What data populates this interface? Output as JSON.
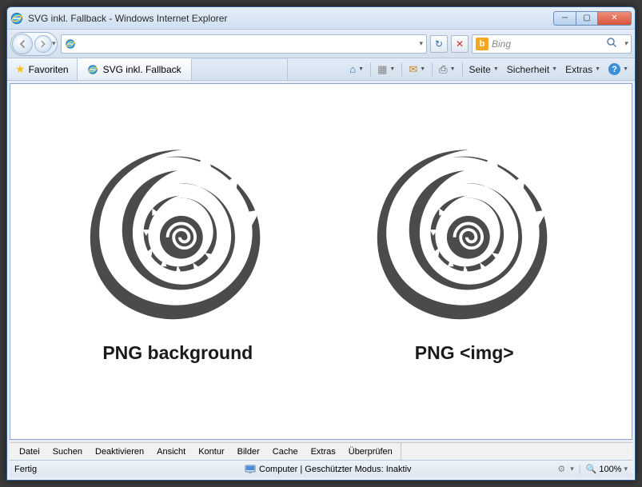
{
  "titlebar": {
    "title": "SVG inkl. Fallback - Windows Internet Explorer"
  },
  "navbar": {
    "address": "",
    "refresh_icon": "↻",
    "stop_icon": "✕",
    "search_engine": "b",
    "search_placeholder": "Bing"
  },
  "favrow": {
    "favorites_label": "Favoriten",
    "tab_title": "SVG inkl. Fallback"
  },
  "cmdbar": {
    "home": "⌂",
    "feeds": "▦",
    "mail": "✉",
    "print": "⎙",
    "page": "Seite",
    "safety": "Sicherheit",
    "extras": "Extras",
    "help": "?"
  },
  "content": {
    "left_caption": "PNG background",
    "right_caption": "PNG <img>"
  },
  "devbar": {
    "items": [
      "Datei",
      "Suchen",
      "Deaktivieren",
      "Ansicht",
      "Kontur",
      "Bilder",
      "Cache",
      "Extras",
      "Überprüfen"
    ]
  },
  "statusbar": {
    "left": "Fertig",
    "center": "Computer | Geschützter Modus: Inaktiv",
    "zoom": "100%"
  }
}
